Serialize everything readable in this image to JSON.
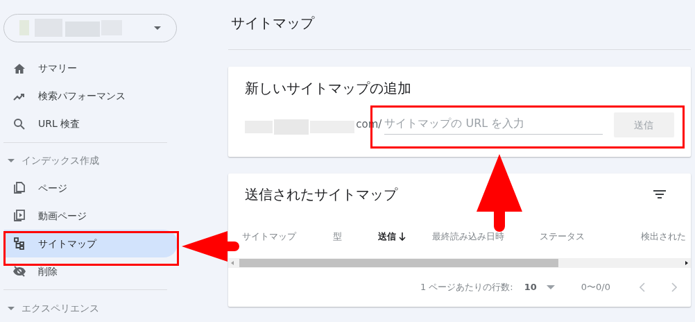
{
  "sidebar": {
    "property_selector": {
      "kind": "blurred"
    },
    "groups": [
      {
        "items": [
          {
            "label": "サマリー",
            "selected": false
          },
          {
            "label": "検索パフォーマンス",
            "selected": false
          },
          {
            "label": "URL 検査",
            "selected": false
          }
        ]
      },
      {
        "title": "インデックス作成",
        "expanded": true,
        "items": [
          {
            "label": "ページ",
            "selected": false
          },
          {
            "label": "動画ページ",
            "selected": false
          },
          {
            "label": "サイトマップ",
            "selected": true
          },
          {
            "label": "削除",
            "selected": false
          }
        ]
      },
      {
        "title": "エクスペリエンス",
        "expanded": true
      }
    ]
  },
  "page_title": "サイトマップ",
  "add_card": {
    "title": "新しいサイトマップの追加",
    "domain_suffix": "com/",
    "placeholder": "サイトマップの URL を入力",
    "submit": {
      "label": "送信",
      "disabled": true
    }
  },
  "submitted_card": {
    "title": "送信されたサイトマップ",
    "columns": [
      {
        "label": "サイトマップ",
        "sorted": false
      },
      {
        "label": "型",
        "sorted": false
      },
      {
        "label": "送信",
        "sorted": true
      },
      {
        "label": "最終読み込み日時",
        "sorted": false
      },
      {
        "label": "ステータス",
        "sorted": false
      },
      {
        "label": "検出された",
        "sorted": false
      }
    ],
    "rows_per_page_label": "1 ページあたりの行数:",
    "rows_per_page": "10",
    "range": "0〜0/0"
  }
}
